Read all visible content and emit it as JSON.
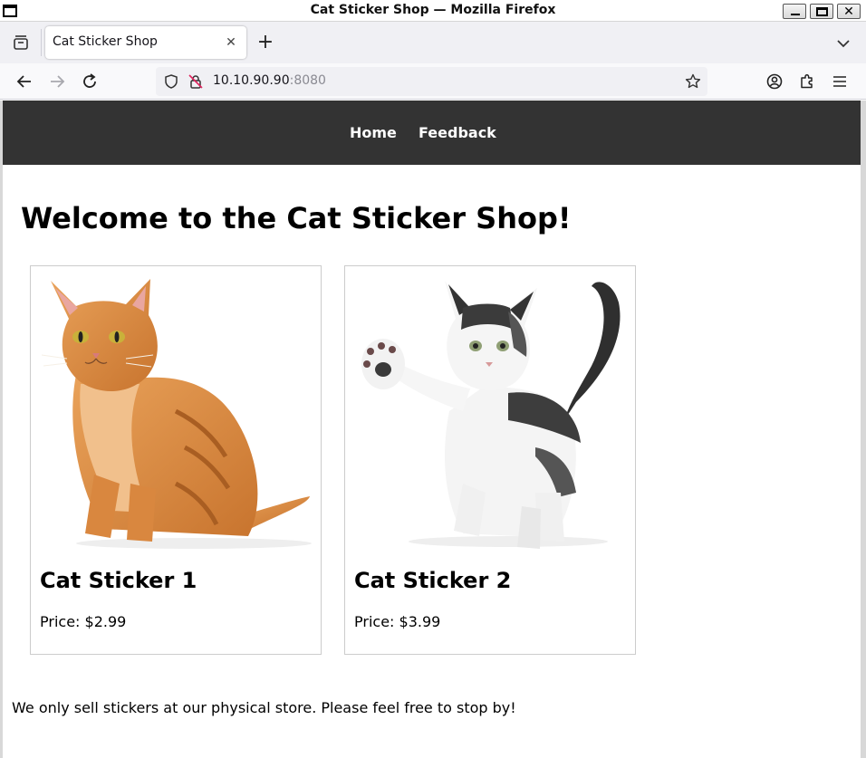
{
  "window": {
    "title": "Cat Sticker Shop — Mozilla Firefox"
  },
  "browser": {
    "tabs": [
      {
        "label": "Cat Sticker Shop",
        "active": true
      }
    ],
    "url": {
      "host": "10.10.90.90",
      "port": ":8080"
    },
    "icons": {
      "tab_list": "tab-list-icon",
      "new_tab": "plus-icon",
      "all_tabs": "chevron-down-icon",
      "back": "arrow-left-icon",
      "forward": "arrow-right-icon",
      "reload": "reload-icon",
      "tracking_protection": "shield-icon",
      "connection": "insecure-lock-icon",
      "bookmark": "star-icon",
      "account": "account-icon",
      "extensions": "puzzle-icon",
      "menu": "hamburger-menu-icon"
    }
  },
  "site": {
    "nav": {
      "home_label": "Home",
      "feedback_label": "Feedback"
    },
    "heading": "Welcome to the Cat Sticker Shop!",
    "products": [
      {
        "name": "Cat Sticker 1",
        "price": "Price: $2.99",
        "image": "orange tabby cat sitting"
      },
      {
        "name": "Cat Sticker 2",
        "price": "Price: $3.99",
        "image": "white and tabby kitten raising paw"
      }
    ],
    "footer_note": "We only sell stickers at our physical store. Please feel free to stop by!"
  },
  "colors": {
    "site_nav_bg": "#333333",
    "site_nav_text": "#ffffff",
    "card_border": "#cccccc",
    "tab_strip_bg": "#f0f0f4",
    "url_bar_bg": "#f0f0f4"
  }
}
